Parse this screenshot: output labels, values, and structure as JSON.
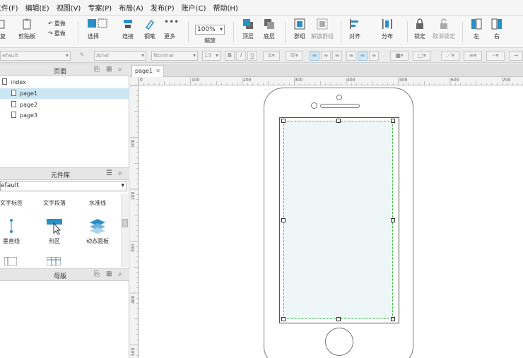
{
  "menu": [
    {
      "label": "文件(F)"
    },
    {
      "label": "编辑(E)"
    },
    {
      "label": "视图(V)"
    },
    {
      "label": "专案(P)"
    },
    {
      "label": "布局(A)"
    },
    {
      "label": "发布(P)"
    },
    {
      "label": "账户(C)"
    },
    {
      "label": "帮助(H)"
    }
  ],
  "toolbar": {
    "paste_label": "剪贴板",
    "paste_prefix": "复",
    "undo_label": "重做",
    "redo_label": "重做",
    "select_label": "选择",
    "connect_label": "连接",
    "pen_label": "钢笔",
    "more_label": "更多",
    "zoom_value": "100%",
    "zoom_label": "缩放",
    "top_label": "顶层",
    "bottom_label": "底层",
    "group_label": "群组",
    "ungroup_label": "解散群组",
    "align_label": "对齐",
    "distribute_label": "分布",
    "lock_label": "锁定",
    "unlock_label": "取消锁定",
    "left_label": "左",
    "right_label": "右"
  },
  "format": {
    "style": "efault",
    "font": "Arial",
    "weight": "Normal",
    "size": "13"
  },
  "pages_panel": {
    "title": "页面",
    "items": [
      {
        "label": "index"
      },
      {
        "label": "page1"
      },
      {
        "label": "page2"
      },
      {
        "label": "page3"
      }
    ]
  },
  "library_panel": {
    "title": "元件库",
    "selected": "efault",
    "items": [
      {
        "label": "文字标签"
      },
      {
        "label": "文字段落"
      },
      {
        "label": "水准线"
      },
      {
        "label": "垂直线"
      },
      {
        "label": "热区"
      },
      {
        "label": "动态面板"
      }
    ]
  },
  "masters_panel": {
    "title": "母版"
  },
  "tabs": [
    {
      "label": "page1"
    }
  ],
  "ruler": {
    "h_labels": [
      "0",
      "100",
      "200",
      "300",
      "400",
      "500",
      "600",
      "700"
    ],
    "v_labels": [
      "100",
      "200",
      "300",
      "400",
      "500"
    ]
  },
  "colors": {
    "selection_bg": "#cce6f4",
    "accent_blue": "#2a8fc7",
    "hotspot_border": "#3fbf3f",
    "hotspot_fill": "#eef6f8"
  }
}
